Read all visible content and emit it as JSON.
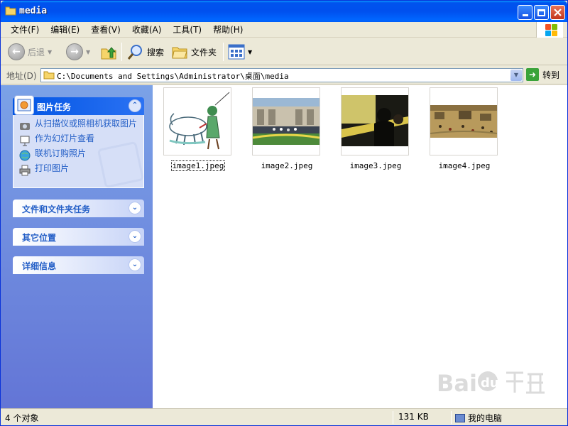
{
  "window": {
    "title": "media",
    "colors": {
      "titlebar": "#0054e3",
      "taskpane": "#6375d6",
      "link": "#215dc6"
    }
  },
  "menubar": {
    "items": [
      "文件(F)",
      "编辑(E)",
      "查看(V)",
      "收藏(A)",
      "工具(T)",
      "帮助(H)"
    ]
  },
  "toolbar": {
    "back_label": "后退",
    "search_label": "搜索",
    "folders_label": "文件夹"
  },
  "address": {
    "label": "地址(D)",
    "value": "C:\\Documents and Settings\\Administrator\\桌面\\media",
    "go_label": "转到"
  },
  "taskpane": {
    "picture_tasks": {
      "title": "图片任务",
      "items": [
        "从扫描仪或照相机获取图片",
        "作为幻灯片查看",
        "联机订购照片",
        "打印图片"
      ]
    },
    "file_tasks": {
      "title": "文件和文件夹任务"
    },
    "other_places": {
      "title": "其它位置"
    },
    "details": {
      "title": "详细信息"
    }
  },
  "files": [
    {
      "name": "image1.jpeg",
      "selected": true,
      "thumb_icon": "ink-painting-thumbnail"
    },
    {
      "name": "image2.jpeg",
      "selected": false,
      "thumb_icon": "plaza-photo-thumbnail"
    },
    {
      "name": "image3.jpeg",
      "selected": false,
      "thumb_icon": "dark-scene-thumbnail"
    },
    {
      "name": "image4.jpeg",
      "selected": false,
      "thumb_icon": "scroll-painting-thumbnail"
    }
  ],
  "statusbar": {
    "object_count": "4 个对象",
    "size": "131 KB",
    "location": "我的电脑"
  }
}
